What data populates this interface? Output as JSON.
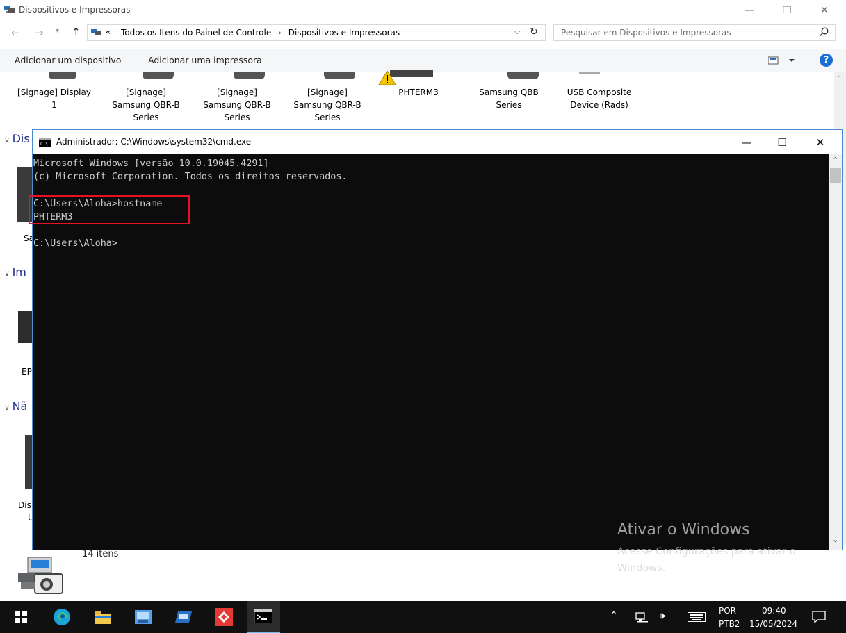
{
  "explorer": {
    "title": "Dispositivos e Impressoras",
    "window_buttons": {
      "minimize": "—",
      "maximize": "❐",
      "close": "✕"
    },
    "address": {
      "segments": [
        "Todos os Itens do Painel de Controle",
        "Dispositivos e Impressoras"
      ],
      "prefix": "«",
      "separator": "›"
    },
    "search_placeholder": "Pesquisar em Dispositivos e Impressoras",
    "commands": {
      "add_device": "Adicionar um dispositivo",
      "add_printer": "Adicionar uma impressora"
    },
    "help_label": "?",
    "devices": [
      {
        "name": "[Signage] Display 1"
      },
      {
        "name": "[Signage] Samsung QBR-B Series"
      },
      {
        "name": "[Signage] Samsung QBR-B Series"
      },
      {
        "name": "[Signage] Samsung QBR-B Series"
      },
      {
        "name": "PHTERM3",
        "warning": true
      },
      {
        "name": "Samsung QBB Series"
      },
      {
        "name": "USB Composite Device (Rads)"
      }
    ],
    "groups": [
      "Dis",
      "Im",
      "Nã"
    ],
    "partial_labels": [
      "Sa",
      "EP",
      "Dis",
      "U"
    ],
    "status_count": "14 itens"
  },
  "cmd": {
    "title": "Administrador: C:\\Windows\\system32\\cmd.exe",
    "lines": [
      "Microsoft Windows [versão 10.0.19045.4291]",
      "(c) Microsoft Corporation. Todos os direitos reservados.",
      "",
      "C:\\Users\\Aloha>hostname",
      "PHTERM3",
      "",
      "C:\\Users\\Aloha>"
    ]
  },
  "watermark": {
    "title": "Ativar o Windows",
    "subtitle": "Acesse Configurações para ativar o Windows."
  },
  "taskbar": {
    "language": "POR",
    "keyboard": "PTB2",
    "time": "09:40",
    "date": "15/05/2024"
  },
  "colors": {
    "accent": "#1a6fd1",
    "highlight": "#e81123",
    "console_bg": "#0c0c0c",
    "console_fg": "#cccccc"
  }
}
